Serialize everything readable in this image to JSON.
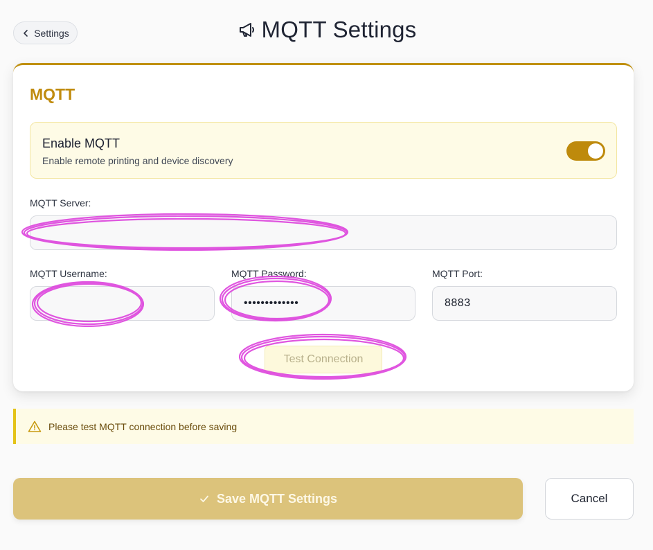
{
  "header": {
    "back_label": "Settings",
    "title": "MQTT Settings",
    "title_icon": "megaphone-icon"
  },
  "card": {
    "heading": "MQTT",
    "enable": {
      "title": "Enable MQTT",
      "description": "Enable remote printing and device discovery",
      "enabled": true
    },
    "server": {
      "label": "MQTT Server:",
      "value": ""
    },
    "username": {
      "label": "MQTT Username:",
      "value": ""
    },
    "password": {
      "label": "MQTT Password:",
      "value": "•••••••••••••"
    },
    "port": {
      "label": "MQTT Port:",
      "value": "8883"
    },
    "test_button": "Test Connection"
  },
  "warning": {
    "icon": "warning-triangle-icon",
    "text": "Please test MQTT connection before saving"
  },
  "actions": {
    "save_label": "Save MQTT Settings",
    "save_icon": "check-icon",
    "cancel_label": "Cancel"
  },
  "colors": {
    "accent": "#c08b0e",
    "toggle_on": "#be8a0c",
    "save_button": "#dcc37b",
    "warning_bg": "#fefbe6",
    "warning_border": "#e4c318",
    "redaction_marker": "#dd44dd"
  }
}
